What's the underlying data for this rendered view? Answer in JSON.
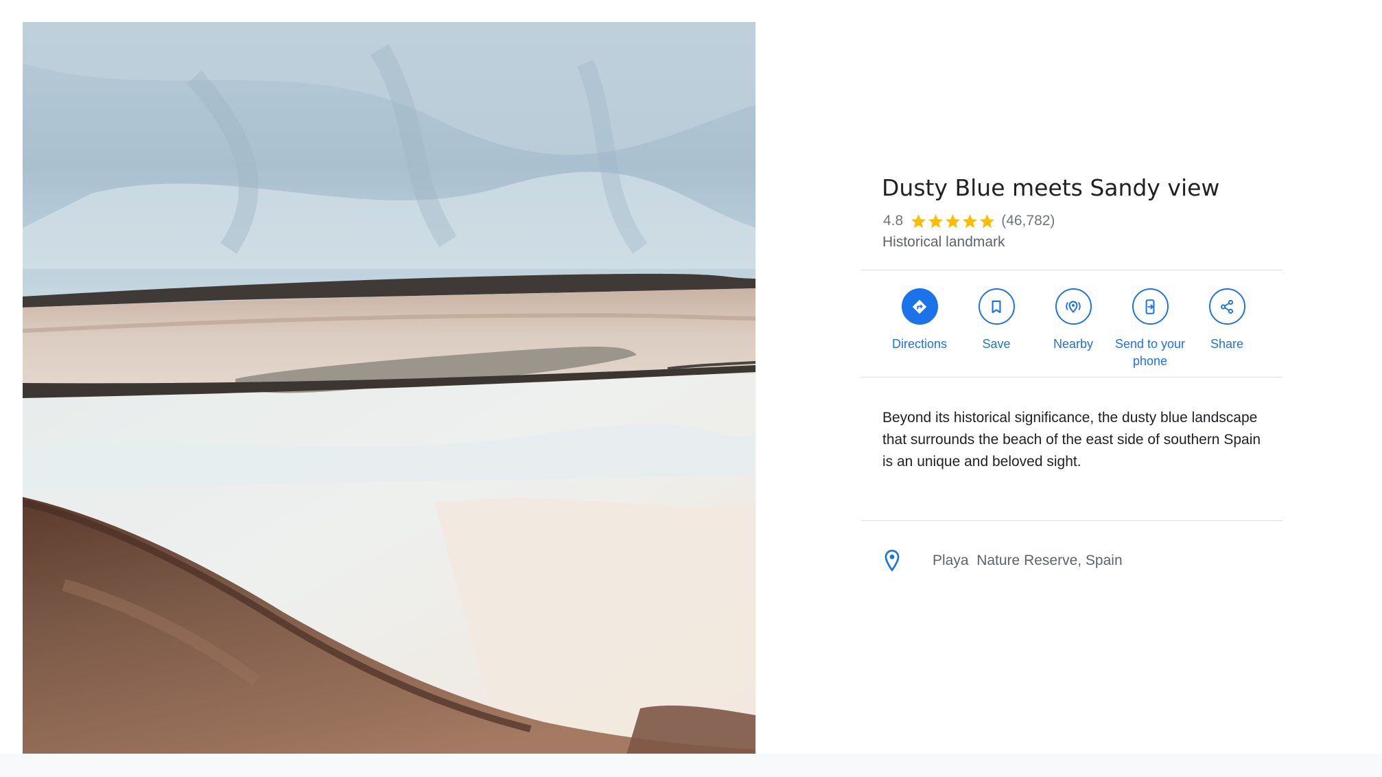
{
  "place": {
    "title": "Dusty Blue meets Sandy view",
    "rating": "4.8",
    "stars": 5,
    "review_count": "(46,782)",
    "category": "Historical landmark"
  },
  "actions": [
    {
      "label": "Directions",
      "icon": "directions-icon"
    },
    {
      "label": "Save",
      "icon": "bookmark-icon"
    },
    {
      "label": "Nearby",
      "icon": "nearby-icon"
    },
    {
      "label": "Send to your phone",
      "icon": "send-to-phone-icon"
    },
    {
      "label": "Share",
      "icon": "share-icon"
    }
  ],
  "description": "Beyond its historical significance, the dusty blue landscape that surrounds the beach of the east side of southern Spain is an unique and beloved sight.",
  "address": "Playa  Nature Reserve, Spain",
  "colors": {
    "accent": "#1a73e8",
    "star": "#fbbc04",
    "text_primary": "#202124",
    "text_secondary": "#5f6368"
  }
}
